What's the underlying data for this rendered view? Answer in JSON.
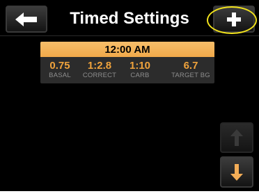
{
  "header": {
    "title": "Timed Settings",
    "back_icon": "left-arrow-icon",
    "add_icon": "plus-icon",
    "highlight_color": "#f2e31c"
  },
  "segment": {
    "time": "12:00 AM",
    "basal": {
      "value": "0.75",
      "label": "BASAL"
    },
    "correct": {
      "value": "1:2.8",
      "label": "CORRECT"
    },
    "carb": {
      "value": "1:10",
      "label": "CARB"
    },
    "target_bg": {
      "value": "6.7",
      "label": "TARGET BG"
    }
  },
  "scroll": {
    "up_icon": "up-arrow-icon",
    "up_enabled": false,
    "down_icon": "down-arrow-icon",
    "down_enabled": true
  },
  "colors": {
    "background": "#000000",
    "accent": "#f0a33c",
    "time_bar": "#f4b45a",
    "label": "#8e8e8e"
  }
}
